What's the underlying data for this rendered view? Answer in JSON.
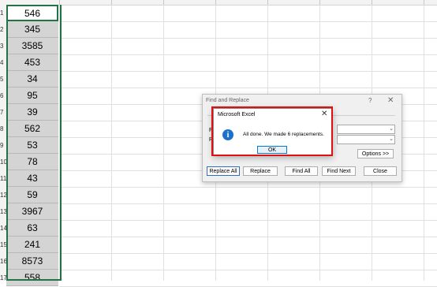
{
  "sheet": {
    "row_numbers": [
      "1",
      "2",
      "3",
      "4",
      "5",
      "6",
      "7",
      "8",
      "9",
      "10",
      "11",
      "12",
      "13",
      "14",
      "15",
      "16",
      "17"
    ],
    "column_a": [
      "546",
      "345",
      "3585",
      "453",
      "34",
      "95",
      "39",
      "562",
      "53",
      "78",
      "43",
      "59",
      "3967",
      "63",
      "241",
      "8573",
      "558"
    ]
  },
  "find_replace": {
    "title": "Find and Replace",
    "help": "?",
    "close": "✕",
    "find_label": "Fi",
    "replace_label": "Re",
    "dropdown": "⌄",
    "options_button": "Options >>",
    "buttons": {
      "replace_all": "Replace All",
      "replace": "Replace",
      "find_all": "Find All",
      "find_next": "Find Next",
      "close": "Close"
    }
  },
  "message_box": {
    "title": "Microsoft Excel",
    "close": "✕",
    "icon": "info-icon",
    "icon_glyph": "i",
    "message": "All done. We made 6 replacements.",
    "ok_button": "OK"
  },
  "colors": {
    "selection_border": "#217346",
    "selected_fill": "#d4d4d4",
    "highlight_outline": "#e01010",
    "info_blue": "#1c71c8"
  }
}
